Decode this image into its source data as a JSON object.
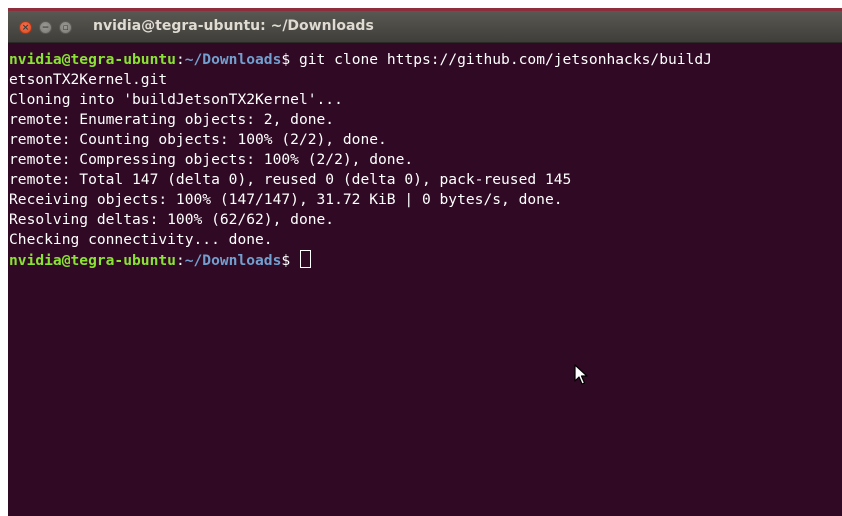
{
  "window": {
    "title": "nvidia@tegra-ubuntu: ~/Downloads",
    "buttons": {
      "close_glyph": "×",
      "minimize_glyph": "−",
      "maximize_glyph": "▫"
    }
  },
  "prompt": {
    "user_host": "nvidia@tegra-ubuntu",
    "separator": ":",
    "path": "~/Downloads",
    "symbol": "$"
  },
  "command": {
    "text_line1": " git clone https://github.com/jetsonhacks/buildJ",
    "text_line2": "etsonTX2Kernel.git"
  },
  "output": [
    "Cloning into 'buildJetsonTX2Kernel'...",
    "remote: Enumerating objects: 2, done.",
    "remote: Counting objects: 100% (2/2), done.",
    "remote: Compressing objects: 100% (2/2), done.",
    "remote: Total 147 (delta 0), reused 0 (delta 0), pack-reused 145",
    "Receiving objects: 100% (147/147), 31.72 KiB | 0 bytes/s, done.",
    "Resolving deltas: 100% (62/62), done.",
    "Checking connectivity... done."
  ],
  "colors": {
    "background": "#300a24",
    "titlebar": "#4a4945",
    "prompt_user": "#8ae234",
    "prompt_path": "#729fcf",
    "text": "#ffffff",
    "close_button": "#e9541f"
  },
  "icons": [
    "close-icon",
    "minimize-icon",
    "maximize-icon",
    "mouse-pointer-icon"
  ]
}
